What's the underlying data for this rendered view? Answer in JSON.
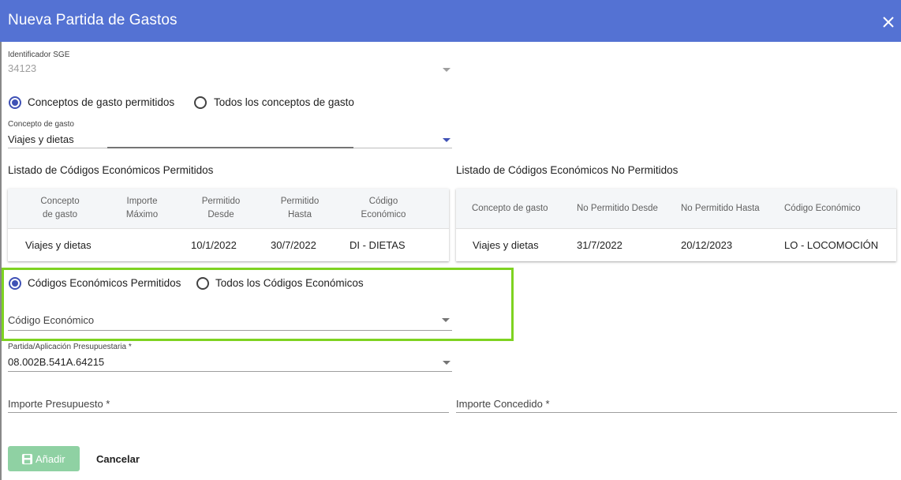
{
  "dialog": {
    "title": "Nueva Partida de Gastos"
  },
  "sge": {
    "label": "Identificador SGE",
    "value": "34123"
  },
  "concept_filter": {
    "option_allowed": "Conceptos de gasto permitidos",
    "option_all": "Todos los conceptos de gasto",
    "selected": "allowed"
  },
  "concepto": {
    "label": "Concepto de gasto",
    "value": "Viajes y dietas"
  },
  "allowed_list": {
    "title": "Listado de Códigos Económicos Permitidos",
    "headers": [
      "Concepto de gasto",
      "Importe Máximo",
      "Permitido Desde",
      "Permitido Hasta",
      "Código Económico"
    ],
    "rows": [
      {
        "concepto": "Viajes y dietas",
        "importe": "",
        "desde": "10/1/2022",
        "hasta": "30/7/2022",
        "codigo": "DI - DIETAS"
      }
    ]
  },
  "not_allowed_list": {
    "title": "Listado de Códigos Económicos No Permitidos",
    "headers": [
      "Concepto de gasto",
      "No Permitido Desde",
      "No Permitido Hasta",
      "Código Económico"
    ],
    "rows": [
      {
        "concepto": "Viajes y dietas",
        "desde": "31/7/2022",
        "hasta": "20/12/2023",
        "codigo": "LO - LOCOMOCIÓN"
      }
    ]
  },
  "code_filter": {
    "option_allowed": "Códigos Económicos Permitidos",
    "option_all": "Todos los Códigos Económicos",
    "selected": "allowed"
  },
  "codigo_economico": {
    "placeholder": "Código Económico"
  },
  "partida": {
    "label": "Partida/Aplicación Presupuestaria *",
    "value": "08.002B.541A.64215"
  },
  "importe_presupuesto": {
    "placeholder": "Importe Presupuesto *"
  },
  "importe_concedido": {
    "placeholder": "Importe Concedido *"
  },
  "actions": {
    "add": "Añadir",
    "cancel": "Cancelar"
  },
  "colors": {
    "header": "#5472d3",
    "accent": "#3f51b5",
    "highlight": "#7ed321",
    "add_button": "#8fd1a3"
  },
  "icons": {
    "close": "close-icon",
    "dropdown": "chevron-down-icon",
    "save": "save-icon"
  }
}
